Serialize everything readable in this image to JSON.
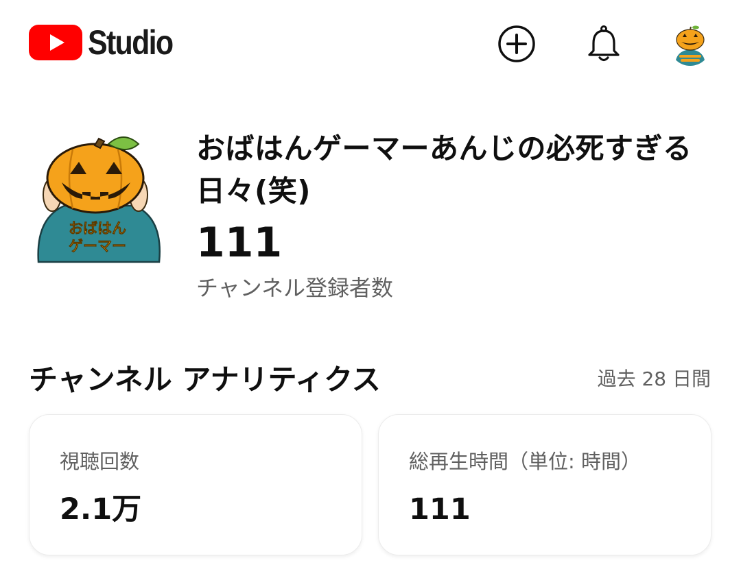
{
  "header": {
    "logo_text": "Studio",
    "create_icon": "create-plus-icon",
    "notifications_icon": "bell-icon",
    "account_avatar": "pumpkin-avatar"
  },
  "channel": {
    "avatar_text_line1": "おばはん",
    "avatar_text_line2": "ゲーマー",
    "name": "おばはんゲーマーあんじの必死すぎる日々(笑)",
    "subscriber_count": "111",
    "subscriber_label": "チャンネル登録者数"
  },
  "analytics": {
    "title": "チャンネル アナリティクス",
    "period": "過去 28 日間",
    "cards": [
      {
        "label": "視聴回数",
        "value": "2.1万"
      },
      {
        "label": "総再生時間（単位: 時間）",
        "value": "111"
      }
    ]
  },
  "colors": {
    "brand_red": "#FF0000",
    "pumpkin_orange": "#F5A21B",
    "hoodie_teal": "#2F8A94",
    "text_primary": "#0F0F0F",
    "text_secondary": "#606060"
  }
}
